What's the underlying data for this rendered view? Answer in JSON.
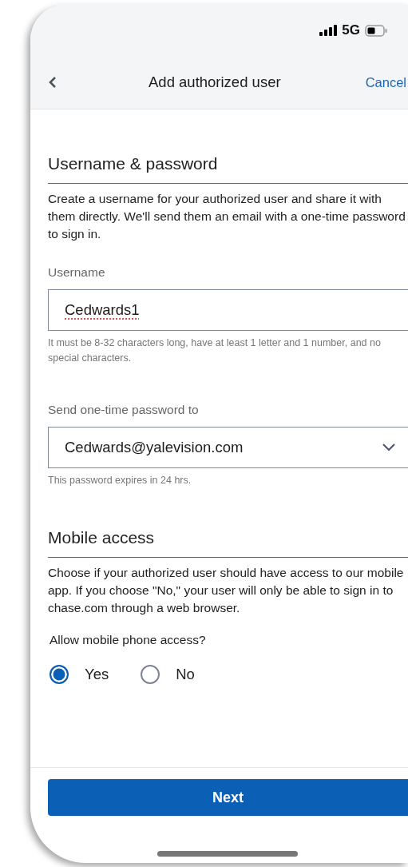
{
  "status_bar": {
    "network": "5G"
  },
  "nav": {
    "title": "Add authorized user",
    "cancel": "Cancel"
  },
  "credentials": {
    "heading": "Username & password",
    "description": "Create a username for your authorized user and share it with them directly. We'll send them an email with a one-time password to sign in.",
    "username": {
      "label": "Username",
      "value": "Cedwards1",
      "hint": "It must be 8-32 characters long, have at least 1 letter and 1 number, and no special characters."
    },
    "send_to": {
      "label": "Send one-time password to",
      "value": "Cedwards@yalevision.com",
      "hint": "This password expires in 24 hrs."
    }
  },
  "mobile_access": {
    "heading": "Mobile access",
    "description": "Choose if your authorized user should have access to our mobile app. If you choose \"No,\" your user will only be able to sign in to chase.com through a web browser.",
    "question": "Allow mobile phone access?",
    "options": [
      {
        "label": "Yes",
        "selected": true
      },
      {
        "label": "No",
        "selected": false
      }
    ]
  },
  "next_button": "Next"
}
